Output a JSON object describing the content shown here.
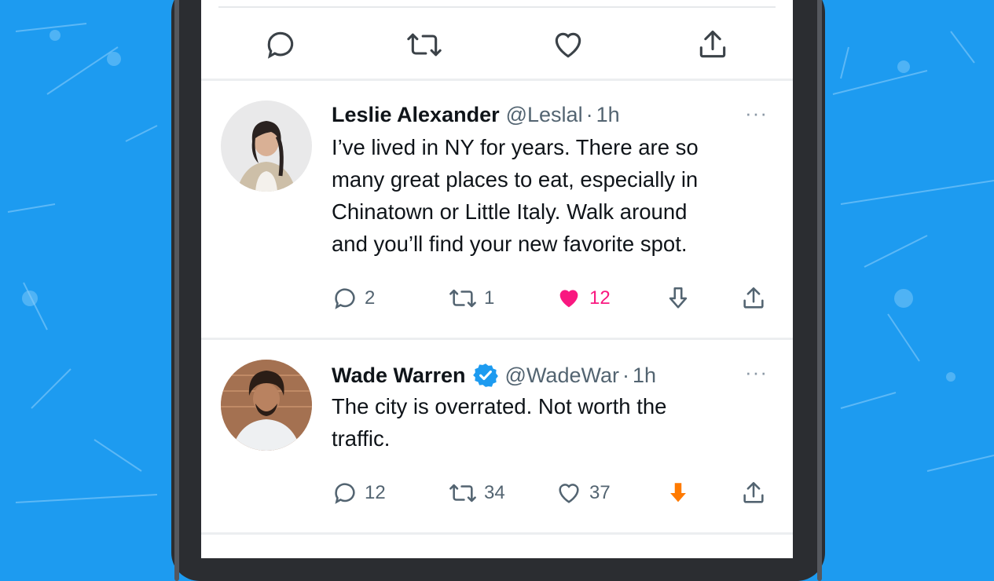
{
  "colors": {
    "background": "#1d9bf0",
    "like_active": "#f91880",
    "downvote_active": "#ff7a00",
    "verified": "#1d9bf0"
  },
  "top_actions": {
    "icons": [
      "reply-icon",
      "retweet-icon",
      "like-icon",
      "share-icon"
    ]
  },
  "tweets": [
    {
      "name": "Leslie Alexander",
      "handle": "@Leslal",
      "dot": "·",
      "time": "1h",
      "verified": false,
      "more": "···",
      "lines": [
        "I’ve lived in NY for years. There are so",
        "many great places to eat, especially in",
        "Chinatown or Little Italy. Walk around",
        "and you’ll find your new favorite spot."
      ],
      "replies": "2",
      "retweets": "1",
      "likes": "12",
      "liked": true,
      "downvoted": false
    },
    {
      "name": "Wade Warren",
      "handle": "@WadeWar",
      "dot": "·",
      "time": "1h",
      "verified": true,
      "more": "···",
      "lines": [
        "The city is overrated. Not worth the",
        "traffic."
      ],
      "replies": "12",
      "retweets": "34",
      "likes": "37",
      "liked": false,
      "downvoted": true
    }
  ]
}
